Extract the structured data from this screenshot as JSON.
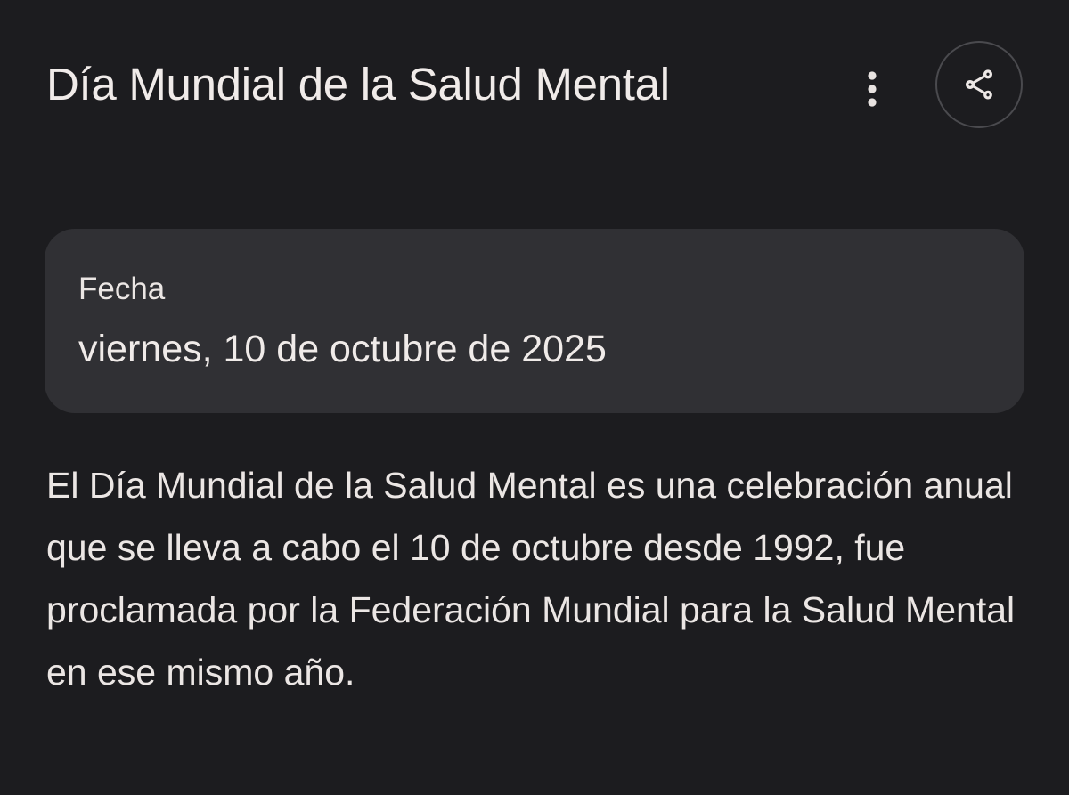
{
  "header": {
    "title": "Día Mundial de la Salud Mental",
    "more_icon": "more-vertical-icon",
    "share_icon": "share-icon"
  },
  "date_card": {
    "label": "Fecha",
    "value": "viernes, 10 de octubre de 2025"
  },
  "description": "El Día Mundial de la Salud Mental es una celebración anual que se lleva a cabo el 10 de octubre desde 1992, fue proclamada por la Federación Mundial para la Salud Mental en ese mismo año.",
  "colors": {
    "background": "#1c1c1f",
    "card": "#303034",
    "text": "#ede8e6",
    "button_border": "#4a4a4e"
  }
}
